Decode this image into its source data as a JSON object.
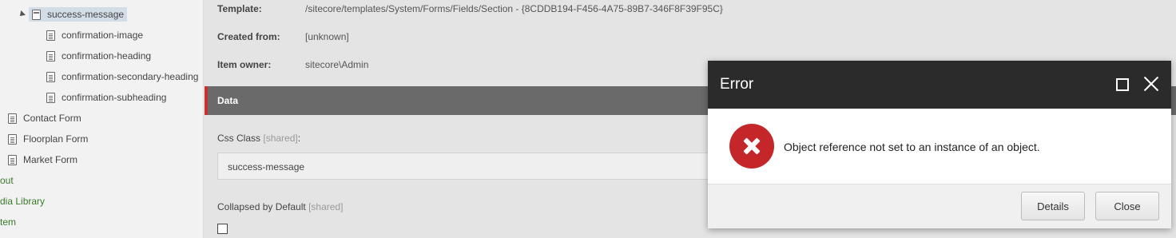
{
  "tree": {
    "items": [
      {
        "label": "success-message"
      },
      {
        "label": "confirmation-image"
      },
      {
        "label": "confirmation-heading"
      },
      {
        "label": "confirmation-secondary-heading"
      },
      {
        "label": "confirmation-subheading"
      },
      {
        "label": "Contact Form"
      },
      {
        "label": "Floorplan Form"
      },
      {
        "label": "Market Form"
      },
      {
        "label": "out"
      },
      {
        "label": "dia Library"
      },
      {
        "label": "tem"
      }
    ]
  },
  "editor": {
    "template_key": "Template:",
    "template_value": "/sitecore/templates/System/Forms/Fields/Section - {8CDDB194-F456-4A75-89B7-346F8F39F95C}",
    "created_from_key": "Created from:",
    "created_from_value": "[unknown]",
    "owner_key": "Item owner:",
    "owner_value": "sitecore\\Admin",
    "section_title": "Data",
    "css_class_label": "Css Class",
    "css_class_shared": "[shared]",
    "css_class_colon": ":",
    "css_class_value": "success-message",
    "collapsed_label": "Collapsed by Default",
    "collapsed_shared": "[shared]",
    "collapsed_checked": false
  },
  "dialog": {
    "title": "Error",
    "message": "Object reference not set to an instance of an object.",
    "details_label": "Details",
    "close_label": "Close",
    "icon": "error-icon",
    "header_color": "#2b2b2b",
    "icon_color": "#c4262a"
  }
}
